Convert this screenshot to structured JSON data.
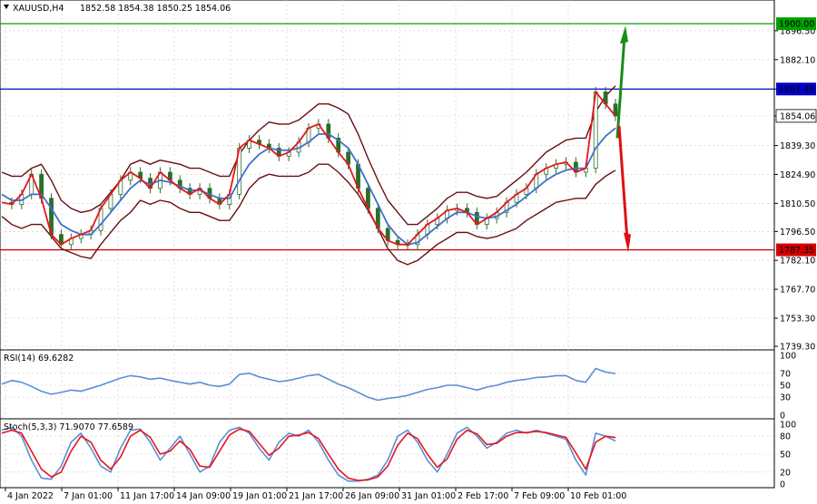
{
  "header": {
    "symbol": "XAUUSD,H4",
    "ohlc": "1852.58 1854.38 1850.25 1854.06",
    "menu_icon": "triangle-down-icon"
  },
  "colors": {
    "background": "#ffffff",
    "grid": "#c8c8c8",
    "bollinger": "#6b0e0e",
    "ma_fast": "#e8141c",
    "ma_slow": "#3e6fcc",
    "candle": "#2a6e2a",
    "resistance_top": "#00a000",
    "resistance_mid": "#0000c8",
    "support": "#d40000",
    "arrow_up": "#1a8a1a",
    "arrow_down": "#e01010",
    "rsi_line": "#5b8fd6",
    "stoch_main": "#5b8fd6",
    "stoch_signal": "#e8141c"
  },
  "chart_data": [
    {
      "type": "line",
      "panel": "price",
      "title": "XAUUSD,H4",
      "ylim": [
        1739.3,
        1910.0
      ],
      "y_ticks": [
        "1896.50",
        "1882.10",
        "1867.45",
        "1854.06",
        "1839.30",
        "1824.90",
        "1810.50",
        "1796.50",
        "1782.10",
        "1767.70",
        "1753.30",
        "1739.30"
      ],
      "x_ticks": [
        "4 Jan 2022",
        "7 Jan 01:00",
        "11 Jan 17:00",
        "14 Jan 09:00",
        "19 Jan 01:00",
        "21 Jan 17:00",
        "26 Jan 09:00",
        "31 Jan 01:00",
        "2 Feb 17:00",
        "7 Feb 09:00",
        "10 Feb 01:00"
      ],
      "series": [
        {
          "values": [
            1811,
            1810,
            1815,
            1825,
            1813,
            1795,
            1790,
            1793,
            1795,
            1797,
            1808,
            1815,
            1822,
            1826,
            1823,
            1818,
            1826,
            1822,
            1818,
            1815,
            1818,
            1813,
            1810,
            1815,
            1838,
            1842,
            1840,
            1838,
            1834,
            1836,
            1841,
            1848,
            1850,
            1843,
            1836,
            1830,
            1818,
            1808,
            1798,
            1792,
            1790,
            1790,
            1795,
            1800,
            1803,
            1807,
            1808,
            1806,
            1800,
            1803,
            1806,
            1811,
            1815,
            1818,
            1825,
            1828,
            1830,
            1831,
            1826,
            1828,
            1866,
            1860,
            1854
          ]
        },
        {
          "values": [
            1815,
            1812,
            1812,
            1815,
            1815,
            1808,
            1800,
            1797,
            1795,
            1795,
            1800,
            1806,
            1812,
            1818,
            1822,
            1820,
            1822,
            1821,
            1819,
            1817,
            1817,
            1815,
            1813,
            1813,
            1822,
            1830,
            1835,
            1838,
            1837,
            1837,
            1838,
            1841,
            1845,
            1845,
            1842,
            1838,
            1830,
            1820,
            1810,
            1800,
            1794,
            1790,
            1791,
            1795,
            1799,
            1803,
            1806,
            1806,
            1804,
            1803,
            1804,
            1807,
            1810,
            1814,
            1818,
            1822,
            1825,
            1827,
            1828,
            1828,
            1838,
            1844,
            1848
          ]
        },
        {
          "values": [
            1826,
            1824,
            1824,
            1828,
            1830,
            1822,
            1812,
            1808,
            1806,
            1807,
            1810,
            1816,
            1822,
            1830,
            1832,
            1830,
            1832,
            1831,
            1830,
            1828,
            1828,
            1826,
            1824,
            1824,
            1835,
            1842,
            1847,
            1851,
            1850,
            1850,
            1852,
            1856,
            1860,
            1860,
            1858,
            1855,
            1845,
            1833,
            1822,
            1812,
            1806,
            1800,
            1800,
            1804,
            1808,
            1813,
            1816,
            1816,
            1814,
            1813,
            1814,
            1818,
            1822,
            1826,
            1831,
            1836,
            1839,
            1842,
            1843,
            1843,
            1856,
            1864,
            1869
          ]
        },
        {
          "values": [
            1804,
            1800,
            1798,
            1800,
            1800,
            1794,
            1788,
            1786,
            1784,
            1783,
            1790,
            1796,
            1802,
            1806,
            1812,
            1810,
            1812,
            1811,
            1808,
            1806,
            1806,
            1804,
            1802,
            1802,
            1809,
            1818,
            1823,
            1825,
            1824,
            1824,
            1824,
            1826,
            1830,
            1830,
            1826,
            1821,
            1815,
            1807,
            1798,
            1788,
            1782,
            1780,
            1782,
            1786,
            1790,
            1793,
            1796,
            1796,
            1794,
            1793,
            1794,
            1796,
            1798,
            1802,
            1805,
            1808,
            1811,
            1812,
            1813,
            1813,
            1820,
            1824,
            1827
          ]
        }
      ],
      "levels": [
        {
          "label": "1900.00",
          "value": 1900.0,
          "color": "#00a000"
        },
        {
          "label": "1867.45",
          "value": 1867.45,
          "color": "#0000c8"
        },
        {
          "label": "1787.35",
          "value": 1787.35,
          "color": "#d40000"
        }
      ],
      "last_price": "1854.06"
    },
    {
      "type": "line",
      "panel": "rsi",
      "title": "RSI(14) 69.6282",
      "ylim": [
        0,
        100
      ],
      "y_ticks": [
        "100",
        "70",
        "50",
        "30",
        "0"
      ],
      "series": [
        {
          "name": "RSI(14)",
          "values": [
            52,
            58,
            55,
            48,
            40,
            35,
            38,
            42,
            40,
            45,
            50,
            56,
            62,
            66,
            64,
            60,
            62,
            58,
            55,
            52,
            55,
            50,
            48,
            52,
            68,
            70,
            64,
            60,
            56,
            58,
            62,
            66,
            68,
            60,
            52,
            46,
            38,
            30,
            25,
            28,
            30,
            33,
            38,
            43,
            46,
            50,
            50,
            46,
            42,
            47,
            50,
            55,
            58,
            60,
            63,
            64,
            66,
            66,
            58,
            55,
            78,
            72,
            69.6
          ]
        }
      ]
    },
    {
      "type": "line",
      "panel": "stochastic",
      "title": "Stoch(5,3,3) 71.9070 77.6589",
      "ylim": [
        0,
        100
      ],
      "y_ticks": [
        "100",
        "80",
        "50",
        "20",
        "0"
      ],
      "series": [
        {
          "name": "Stoch main",
          "values": [
            90,
            95,
            80,
            40,
            10,
            8,
            30,
            70,
            85,
            60,
            30,
            20,
            60,
            90,
            92,
            70,
            40,
            60,
            80,
            50,
            20,
            30,
            70,
            90,
            95,
            85,
            60,
            40,
            70,
            85,
            80,
            90,
            70,
            40,
            15,
            5,
            5,
            8,
            15,
            40,
            80,
            90,
            70,
            40,
            20,
            50,
            85,
            95,
            80,
            60,
            70,
            85,
            90,
            85,
            90,
            85,
            80,
            75,
            40,
            15,
            85,
            80,
            71.9
          ]
        },
        {
          "name": "Stoch signal",
          "values": [
            85,
            90,
            85,
            55,
            25,
            12,
            20,
            55,
            80,
            70,
            40,
            25,
            45,
            80,
            90,
            78,
            50,
            55,
            72,
            58,
            30,
            28,
            55,
            82,
            92,
            88,
            68,
            48,
            60,
            80,
            82,
            86,
            76,
            50,
            25,
            10,
            6,
            7,
            12,
            30,
            65,
            85,
            76,
            50,
            28,
            42,
            75,
            90,
            84,
            66,
            68,
            80,
            86,
            86,
            88,
            86,
            82,
            78,
            52,
            25,
            70,
            80,
            77.7
          ]
        }
      ]
    }
  ]
}
